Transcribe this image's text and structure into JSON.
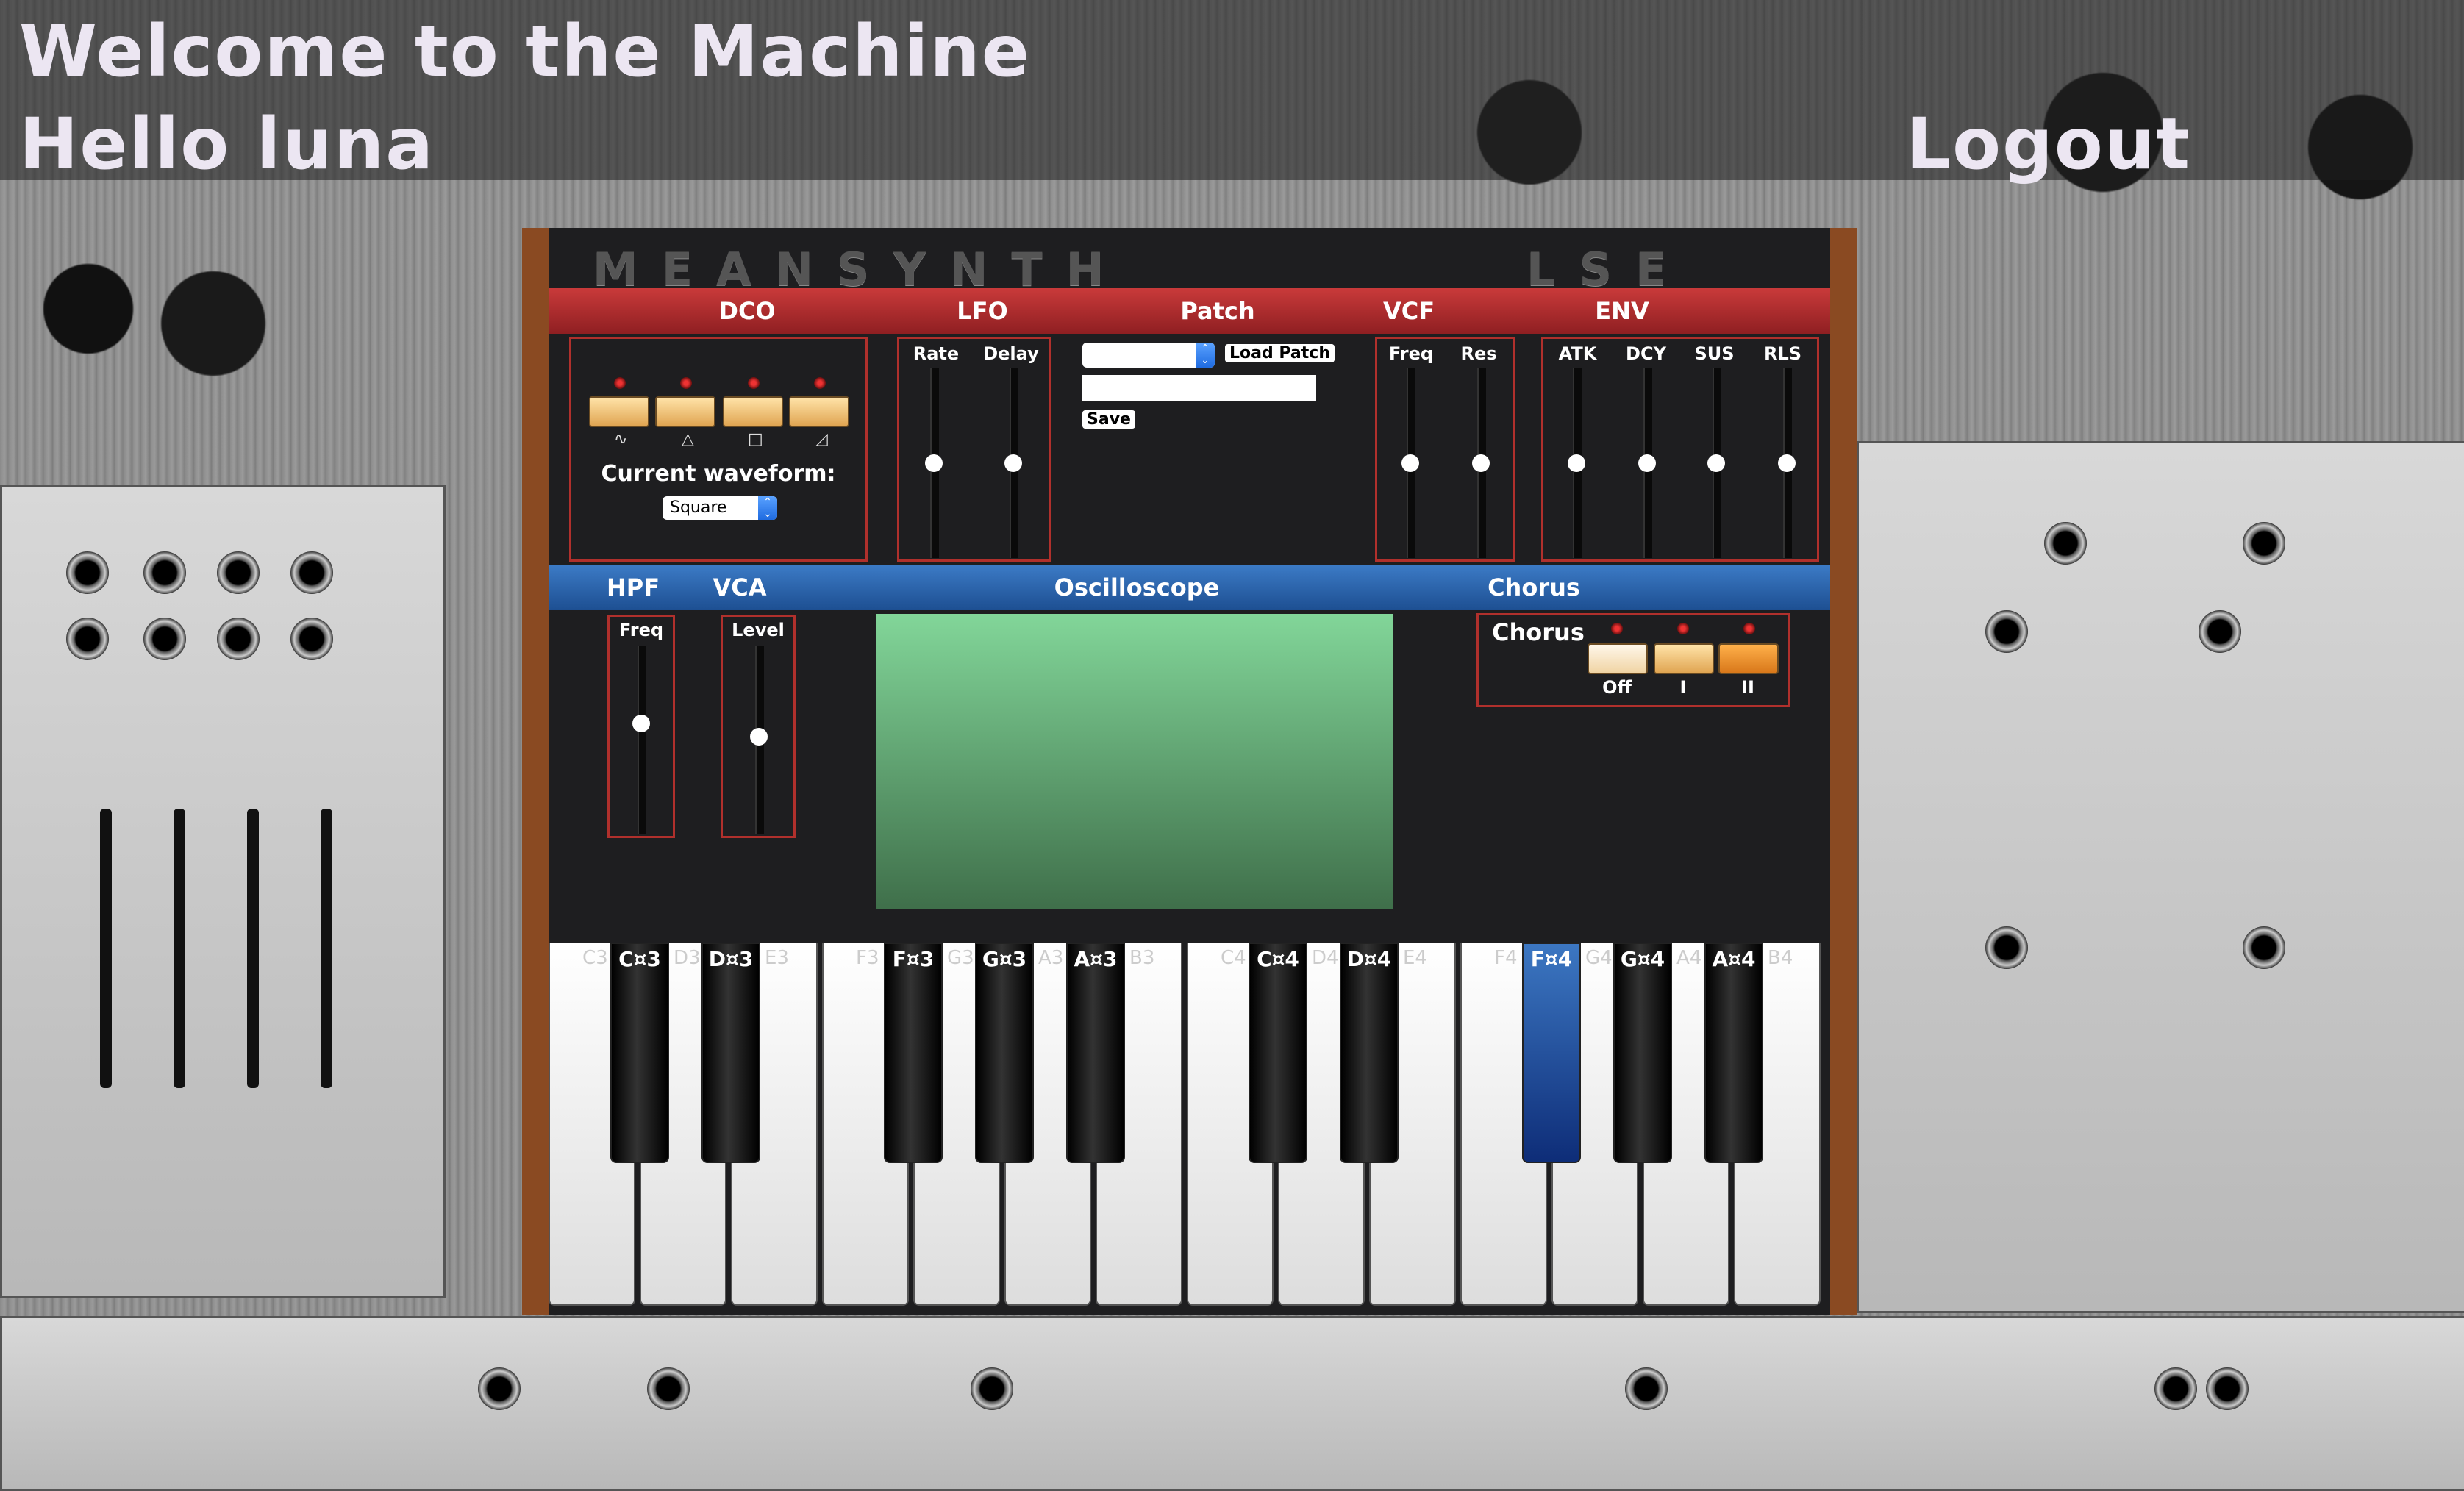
{
  "header": {
    "welcome": "Welcome to the Machine",
    "greeting": "Hello luna",
    "logout": "Logout"
  },
  "synth": {
    "brand": "MEANSYNTH",
    "brand_suffix": "LSE",
    "sections_top": {
      "dco": "DCO",
      "lfo": "LFO",
      "patch": "Patch",
      "vcf": "VCF",
      "env": "ENV"
    },
    "sections_bottom": {
      "hpf": "HPF",
      "vca": "VCA",
      "oscilloscope": "Oscilloscope",
      "chorus": "Chorus"
    },
    "dco": {
      "waveform_symbols": [
        "∿",
        "△",
        "□",
        "◿"
      ],
      "current_label": "Current waveform:",
      "current_value": "Square"
    },
    "lfo": {
      "rate_label": "Rate",
      "delay_label": "Delay",
      "rate_level": 0.5,
      "delay_level": 0.5
    },
    "patch": {
      "select_value": "",
      "load_label": "Load Patch",
      "name_value": "",
      "save_label": "Save"
    },
    "vcf": {
      "freq_label": "Freq",
      "res_label": "Res",
      "freq_level": 0.5,
      "res_level": 0.5
    },
    "env": {
      "labels": [
        "ATK",
        "DCY",
        "SUS",
        "RLS"
      ],
      "levels": [
        0.5,
        0.5,
        0.5,
        0.5
      ]
    },
    "hpf": {
      "freq_label": "Freq",
      "level": 0.6
    },
    "vca": {
      "level_label": "Level",
      "level": 0.52
    },
    "chorus": {
      "label": "Chorus",
      "options": [
        "Off",
        "I",
        "II"
      ],
      "selected": "II"
    },
    "keyboard": {
      "white_keys": [
        "C3",
        "D3",
        "E3",
        "F3",
        "G3",
        "A3",
        "B3",
        "C4",
        "D4",
        "E4",
        "F4",
        "G4",
        "A4",
        "B4"
      ],
      "black_keys": [
        "C¤3",
        "D¤3",
        "F¤3",
        "G¤3",
        "A¤3",
        "C¤4",
        "D¤4",
        "F¤4",
        "G¤4",
        "A¤4"
      ],
      "active_key": "F¤4"
    }
  }
}
